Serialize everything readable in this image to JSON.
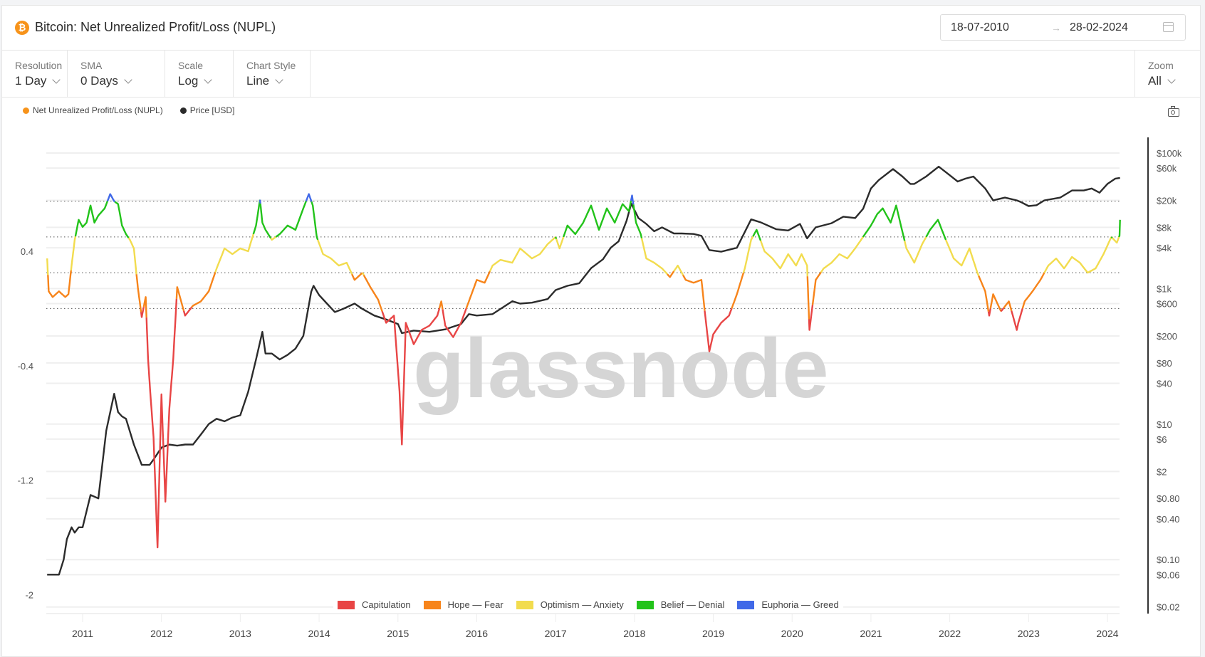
{
  "header": {
    "title": "Bitcoin: Net Unrealized Profit/Loss (NUPL)",
    "asset_icon": "bitcoin-icon",
    "date_start": "18-07-2010",
    "date_arrow": "→",
    "date_end": "28-02-2024"
  },
  "toolbar": {
    "controls": [
      {
        "label": "Resolution",
        "value": "1 Day"
      },
      {
        "label": "SMA",
        "value": "0 Days"
      },
      {
        "label": "Scale",
        "value": "Log"
      },
      {
        "label": "Chart Style",
        "value": "Line"
      }
    ],
    "zoom": {
      "label": "Zoom",
      "value": "All"
    }
  },
  "legend_top": [
    {
      "label": "Net Unrealized Profit/Loss (NUPL)",
      "color": "#f7931a"
    },
    {
      "label": "Price [USD]",
      "color": "#2b2b2b"
    }
  ],
  "legend_bottom": [
    {
      "label": "Capitulation",
      "color": "#e84545"
    },
    {
      "label": "Hope — Fear",
      "color": "#f7841a"
    },
    {
      "label": "Optimism — Anxiety",
      "color": "#f2dc4e"
    },
    {
      "label": "Belief — Denial",
      "color": "#22c31a"
    },
    {
      "label": "Euphoria — Greed",
      "color": "#4169e8"
    }
  ],
  "watermark": "glassnode",
  "chart_data": {
    "type": "line",
    "title": "Bitcoin: Net Unrealized Profit/Loss (NUPL)",
    "xlabel": "",
    "x_ticks": [
      "2011",
      "2012",
      "2013",
      "2014",
      "2015",
      "2016",
      "2017",
      "2018",
      "2019",
      "2020",
      "2021",
      "2022",
      "2023",
      "2024"
    ],
    "x_range": [
      "2010-07-18",
      "2024-02-28"
    ],
    "left_axis": {
      "label": "NUPL",
      "ticks": [
        "0.4",
        "-0.4",
        "-1.2",
        "-2"
      ],
      "range": [
        -2,
        1.0
      ]
    },
    "right_axis": {
      "label": "Price [USD]",
      "scale": "log",
      "ticks": [
        "$100k",
        "$60k",
        "$20k",
        "$8k",
        "$4k",
        "$1k",
        "$600",
        "$200",
        "$80",
        "$40",
        "$10",
        "$6",
        "$2",
        "$0.80",
        "$0.40",
        "$0.10",
        "$0.06",
        "$0.02"
      ],
      "range": [
        0.02,
        100000
      ]
    },
    "zone_thresholds": [
      0,
      0.25,
      0.5,
      0.75
    ],
    "zones": [
      {
        "name": "Capitulation",
        "range": [
          -2,
          0
        ],
        "color": "#e84545"
      },
      {
        "name": "Hope — Fear",
        "range": [
          0,
          0.25
        ],
        "color": "#f7841a"
      },
      {
        "name": "Optimism — Anxiety",
        "range": [
          0.25,
          0.5
        ],
        "color": "#f2dc4e"
      },
      {
        "name": "Belief — Denial",
        "range": [
          0.5,
          0.75
        ],
        "color": "#22c31a"
      },
      {
        "name": "Euphoria — Greed",
        "range": [
          0.75,
          1
        ],
        "color": "#4169e8"
      }
    ],
    "series": [
      {
        "name": "Net Unrealized Profit/Loss (NUPL)",
        "x": [
          2010.55,
          2010.57,
          2010.62,
          2010.7,
          2010.78,
          2010.82,
          2010.86,
          2010.9,
          2010.95,
          2011.0,
          2011.05,
          2011.1,
          2011.15,
          2011.2,
          2011.28,
          2011.35,
          2011.4,
          2011.45,
          2011.5,
          2011.55,
          2011.6,
          2011.65,
          2011.7,
          2011.75,
          2011.8,
          2011.83,
          2011.86,
          2011.9,
          2011.95,
          2012.0,
          2012.05,
          2012.1,
          2012.15,
          2012.2,
          2012.3,
          2012.4,
          2012.5,
          2012.6,
          2012.7,
          2012.8,
          2012.9,
          2013.0,
          2013.1,
          2013.2,
          2013.25,
          2013.28,
          2013.32,
          2013.4,
          2013.5,
          2013.6,
          2013.7,
          2013.8,
          2013.87,
          2013.92,
          2013.97,
          2014.05,
          2014.15,
          2014.25,
          2014.35,
          2014.45,
          2014.55,
          2014.65,
          2014.75,
          2014.85,
          2014.95,
          2015.02,
          2015.05,
          2015.1,
          2015.2,
          2015.3,
          2015.4,
          2015.5,
          2015.55,
          2015.6,
          2015.7,
          2015.8,
          2015.9,
          2016.0,
          2016.1,
          2016.2,
          2016.3,
          2016.45,
          2016.55,
          2016.7,
          2016.8,
          2016.9,
          2017.0,
          2017.05,
          2017.15,
          2017.25,
          2017.35,
          2017.45,
          2017.55,
          2017.65,
          2017.75,
          2017.85,
          2017.93,
          2017.97,
          2018.02,
          2018.08,
          2018.15,
          2018.25,
          2018.35,
          2018.45,
          2018.55,
          2018.65,
          2018.75,
          2018.85,
          2018.9,
          2018.95,
          2019.0,
          2019.1,
          2019.2,
          2019.3,
          2019.4,
          2019.48,
          2019.55,
          2019.65,
          2019.75,
          2019.85,
          2019.95,
          2020.05,
          2020.12,
          2020.19,
          2020.22,
          2020.3,
          2020.4,
          2020.5,
          2020.6,
          2020.7,
          2020.8,
          2020.9,
          2021.0,
          2021.08,
          2021.15,
          2021.25,
          2021.32,
          2021.38,
          2021.45,
          2021.55,
          2021.65,
          2021.75,
          2021.85,
          2021.95,
          2022.05,
          2022.15,
          2022.25,
          2022.35,
          2022.45,
          2022.5,
          2022.55,
          2022.65,
          2022.75,
          2022.85,
          2022.87,
          2022.95,
          2023.05,
          2023.15,
          2023.25,
          2023.35,
          2023.45,
          2023.55,
          2023.65,
          2023.75,
          2023.85,
          2023.95,
          2024.05,
          2024.12,
          2024.16
        ],
        "y": [
          0.35,
          0.12,
          0.08,
          0.12,
          0.08,
          0.1,
          0.3,
          0.48,
          0.62,
          0.57,
          0.6,
          0.72,
          0.6,
          0.65,
          0.7,
          0.8,
          0.75,
          0.73,
          0.58,
          0.52,
          0.48,
          0.42,
          0.15,
          -0.06,
          0.08,
          -0.35,
          -0.6,
          -0.9,
          -1.67,
          -0.6,
          -1.35,
          -0.7,
          -0.35,
          0.15,
          -0.05,
          0.02,
          0.05,
          0.12,
          0.28,
          0.42,
          0.38,
          0.42,
          0.4,
          0.58,
          0.76,
          0.6,
          0.55,
          0.48,
          0.52,
          0.58,
          0.55,
          0.7,
          0.8,
          0.72,
          0.5,
          0.38,
          0.35,
          0.3,
          0.32,
          0.2,
          0.25,
          0.15,
          0.06,
          -0.1,
          -0.05,
          -0.58,
          -0.95,
          -0.1,
          -0.25,
          -0.15,
          -0.12,
          -0.05,
          0.05,
          -0.12,
          -0.2,
          -0.1,
          0.05,
          0.2,
          0.18,
          0.3,
          0.34,
          0.32,
          0.42,
          0.35,
          0.38,
          0.45,
          0.5,
          0.42,
          0.58,
          0.52,
          0.6,
          0.72,
          0.55,
          0.7,
          0.6,
          0.73,
          0.68,
          0.79,
          0.6,
          0.52,
          0.35,
          0.32,
          0.28,
          0.22,
          0.3,
          0.2,
          0.18,
          0.2,
          -0.06,
          -0.3,
          -0.18,
          -0.1,
          -0.05,
          0.1,
          0.28,
          0.48,
          0.55,
          0.4,
          0.35,
          0.28,
          0.38,
          0.3,
          0.38,
          0.3,
          -0.15,
          0.2,
          0.28,
          0.32,
          0.38,
          0.35,
          0.42,
          0.5,
          0.58,
          0.66,
          0.7,
          0.6,
          0.72,
          0.58,
          0.42,
          0.32,
          0.45,
          0.55,
          0.62,
          0.48,
          0.35,
          0.3,
          0.42,
          0.25,
          0.12,
          -0.05,
          0.1,
          -0.02,
          0.05,
          -0.15,
          -0.1,
          0.05,
          0.12,
          0.2,
          0.3,
          0.35,
          0.28,
          0.36,
          0.32,
          0.25,
          0.28,
          0.38,
          0.5,
          0.46,
          0.52,
          0.62
        ],
        "color_by_zone": true
      },
      {
        "name": "Price [USD]",
        "x": [
          2010.55,
          2010.6,
          2010.7,
          2010.76,
          2010.8,
          2010.86,
          2010.9,
          2010.95,
          2011.0,
          2011.1,
          2011.2,
          2011.3,
          2011.4,
          2011.45,
          2011.5,
          2011.55,
          2011.65,
          2011.75,
          2011.85,
          2011.9,
          2012.0,
          2012.1,
          2012.2,
          2012.3,
          2012.4,
          2012.5,
          2012.6,
          2012.7,
          2012.8,
          2012.9,
          2013.0,
          2013.1,
          2013.2,
          2013.28,
          2013.32,
          2013.4,
          2013.5,
          2013.6,
          2013.7,
          2013.8,
          2013.9,
          2013.93,
          2014.0,
          2014.1,
          2014.2,
          2014.3,
          2014.45,
          2014.55,
          2014.7,
          2014.85,
          2015.0,
          2015.05,
          2015.2,
          2015.4,
          2015.6,
          2015.8,
          2015.9,
          2016.0,
          2016.2,
          2016.45,
          2016.55,
          2016.7,
          2016.9,
          2017.0,
          2017.15,
          2017.3,
          2017.45,
          2017.6,
          2017.7,
          2017.8,
          2017.9,
          2017.96,
          2018.05,
          2018.15,
          2018.25,
          2018.35,
          2018.5,
          2018.6,
          2018.75,
          2018.85,
          2018.95,
          2019.1,
          2019.3,
          2019.48,
          2019.6,
          2019.8,
          2019.95,
          2020.1,
          2020.19,
          2020.3,
          2020.5,
          2020.65,
          2020.8,
          2020.9,
          2021.0,
          2021.1,
          2021.28,
          2021.4,
          2021.5,
          2021.55,
          2021.7,
          2021.86,
          2022.0,
          2022.1,
          2022.2,
          2022.3,
          2022.45,
          2022.55,
          2022.7,
          2022.85,
          2022.9,
          2023.0,
          2023.1,
          2023.2,
          2023.4,
          2023.55,
          2023.7,
          2023.8,
          2023.9,
          2024.0,
          2024.1,
          2024.16
        ],
        "y": [
          0.06,
          0.06,
          0.06,
          0.1,
          0.2,
          0.3,
          0.25,
          0.3,
          0.3,
          0.9,
          0.8,
          8,
          28,
          15,
          13,
          12,
          5,
          2.5,
          2.5,
          3,
          4.5,
          5,
          4.8,
          5,
          5,
          7,
          10,
          12,
          11,
          12.5,
          13.5,
          30,
          90,
          230,
          110,
          110,
          90,
          105,
          130,
          200,
          900,
          1100,
          800,
          600,
          450,
          500,
          600,
          500,
          400,
          350,
          300,
          220,
          240,
          230,
          250,
          300,
          420,
          400,
          420,
          650,
          600,
          620,
          700,
          950,
          1100,
          1200,
          2000,
          2700,
          4000,
          5000,
          10000,
          18000,
          11000,
          9000,
          7000,
          8000,
          6500,
          6500,
          6400,
          6000,
          3700,
          3500,
          4000,
          10500,
          9500,
          7500,
          7200,
          9000,
          5500,
          8000,
          9200,
          11500,
          11000,
          15000,
          30000,
          40000,
          58000,
          45000,
          35000,
          35000,
          45000,
          63000,
          47000,
          38000,
          42000,
          45000,
          30000,
          20000,
          22000,
          20000,
          19000,
          16500,
          17000,
          20000,
          22000,
          28000,
          28000,
          30000,
          26000,
          35000,
          42000,
          43000,
          45000,
          62000
        ]
      }
    ]
  }
}
